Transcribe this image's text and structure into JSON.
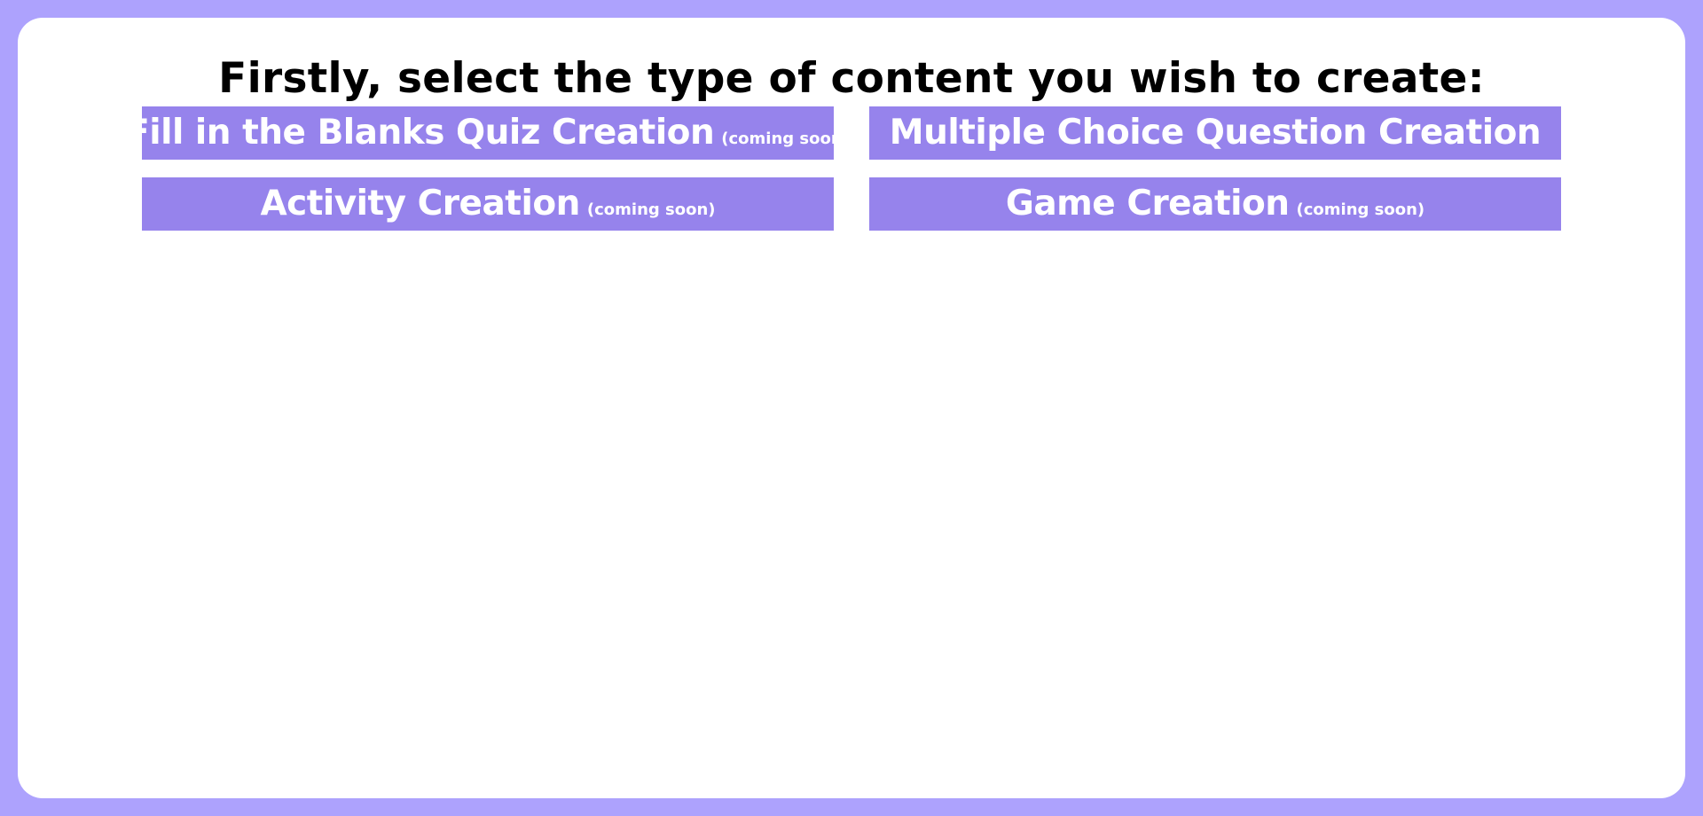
{
  "page": {
    "heading": "Firstly, select the type of content you wish to create:"
  },
  "options": [
    {
      "label": "Fill in the Blanks Quiz Creation",
      "note": "(coming soon)"
    },
    {
      "label": "Multiple Choice Question Creation",
      "note": ""
    },
    {
      "label": "Activity Creation",
      "note": "(coming soon)"
    },
    {
      "label": "Game Creation",
      "note": "(coming soon)"
    }
  ],
  "colors": {
    "background": "#ADA2FD",
    "panel": "#FFFFFF",
    "button": "#9683EC",
    "button_text": "#FFFFFF",
    "heading_text": "#000000"
  }
}
